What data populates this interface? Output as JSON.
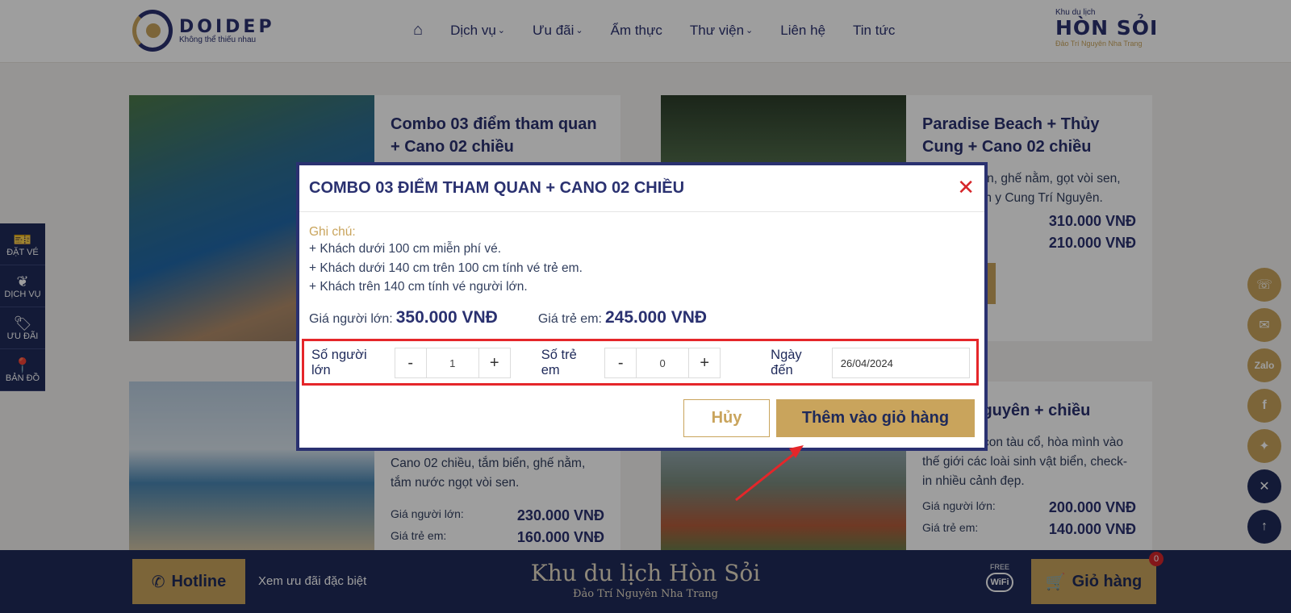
{
  "header": {
    "logo_brand": "DOIDEP",
    "logo_tagline": "Không thể thiếu nhau",
    "nav": [
      "Dịch vụ",
      "Ưu đãi",
      "Ẩm thực",
      "Thư viện",
      "Liên hệ",
      "Tin tức"
    ],
    "right_logo_small": "Khu du lịch",
    "right_logo_big": "HÒN SỎI",
    "right_logo_sub": "Đảo Trí Nguyên Nha Trang"
  },
  "cards": [
    {
      "title": "Combo 03 điểm tham quan + Cano 02 chiều"
    },
    {
      "title": "Paradise Beach + Thủy Cung + Cano 02 chiều",
      "desc": "iều, tắm biển, ghế nằm, gọt vòi sen, hồ bơi, miễn y Cung Trí Nguyên.",
      "adult_label": "n:",
      "adult_price": "310.000 VNĐ",
      "child_price": "210.000 VNĐ",
      "book_label": "ngay"
    },
    {
      "desc": "Cano 02 chiều, tắm biển, ghế nằm, tắm nước ngọt vòi sen.",
      "adult_label": "Giá người lớn:",
      "adult_price": "230.000 VNĐ",
      "child_label": "Giá trẻ em:",
      "child_price": "160.000 VNĐ"
    },
    {
      "title": "ng Trí Nguyên + chiều",
      "desc": "Khám phá con tàu cổ, hòa mình vào thế giới các loài sinh vật biển, check-in nhiều cảnh đẹp.",
      "adult_label": "Giá người lớn:",
      "adult_price": "200.000 VNĐ",
      "child_label": "Giá trẻ em:",
      "child_price": "140.000 VNĐ"
    }
  ],
  "sidebar": [
    "ĐẶT VÉ",
    "DỊCH VỤ",
    "ƯU ĐÃI",
    "BẢN ĐỒ"
  ],
  "floating": [
    "Zalo"
  ],
  "bottom": {
    "hotline": "Hotline",
    "promo": "Xem ưu đãi đặc biệt",
    "site_name": "Khu du lịch Hòn Sỏi",
    "site_sub": "Đảo Trí Nguyên Nha Trang",
    "wifi_free": "FREE",
    "wifi": "WiFi",
    "cart": "Giỏ hàng",
    "cart_count": "0"
  },
  "modal": {
    "title": "COMBO 03 ĐIỂM THAM QUAN + CANO 02 CHIỀU",
    "note_label": "Ghi chú:",
    "notes": [
      "+ Khách dưới 100 cm miễn phí vé.",
      "+ Khách dưới 140 cm trên 100 cm tính vé trẻ em.",
      "+ Khách trên 140 cm tính vé người lớn."
    ],
    "adult_price_label": "Giá người lớn:",
    "adult_price": "350.000 VNĐ",
    "child_price_label": "Giá trẻ em:",
    "child_price": "245.000 VNĐ",
    "adult_qty_label": "Số người lớn",
    "adult_qty": "1",
    "child_qty_label": "Số trẻ em",
    "child_qty": "0",
    "minus": "-",
    "plus": "+",
    "date_label": "Ngày đến",
    "date_value": "26/04/2024",
    "cancel": "Hủy",
    "add_to_cart": "Thêm vào giỏ hàng"
  },
  "colors": {
    "navy": "#2a3170",
    "gold": "#c9a45c",
    "highlight_red": "#e5262a"
  }
}
